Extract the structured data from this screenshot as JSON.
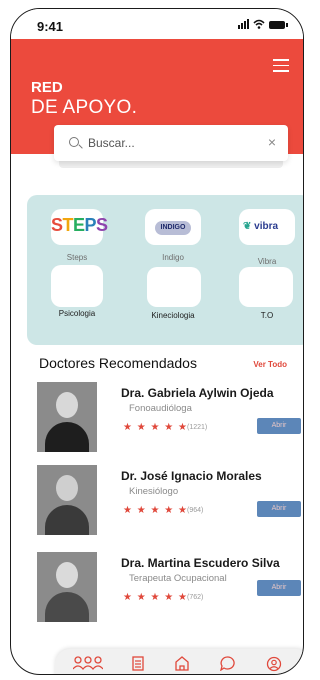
{
  "status": {
    "time": "9:41"
  },
  "header": {
    "title_line1": "RED",
    "title_line2": "DE APOYO."
  },
  "search": {
    "placeholder": "Buscar...",
    "clear_icon": "x-icon"
  },
  "categories": [
    {
      "label": "Steps",
      "logo_text": "STEPS"
    },
    {
      "label": "Indigo",
      "logo_text": "INDIGO"
    },
    {
      "label": "Vibra",
      "logo_text": "vibra"
    }
  ],
  "specialties": [
    {
      "label": "Psicologia"
    },
    {
      "label": "Kineciologia"
    },
    {
      "label": "T.O"
    }
  ],
  "recommended": {
    "title": "Doctores Recomendados",
    "see_all": "Ver Todo",
    "doctors": [
      {
        "name": "Dra. Gabriela Aylwin Ojeda",
        "specialty": "Fonoaudióloga",
        "stars": "★ ★ ★ ★ ★",
        "reviews": "(1221)",
        "button": "Abrir"
      },
      {
        "name": "Dr. José Ignacio Morales",
        "specialty": "Kinesiólogo",
        "stars": "★ ★ ★ ★ ★",
        "reviews": "(964)",
        "button": "Abrir"
      },
      {
        "name": "Dra. Martina Escudero Silva",
        "specialty": "Terapeuta Ocupacional",
        "stars": "★ ★ ★ ★ ★",
        "reviews": "(762)",
        "button": "Abrir"
      }
    ]
  },
  "colors": {
    "accent": "#ec4a3d",
    "panel": "#cde6e6",
    "button": "#5c86b8"
  },
  "nav": [
    {
      "icon": "people-icon"
    },
    {
      "icon": "document-icon"
    },
    {
      "icon": "home-icon"
    },
    {
      "icon": "chat-icon"
    },
    {
      "icon": "profile-icon"
    }
  ]
}
